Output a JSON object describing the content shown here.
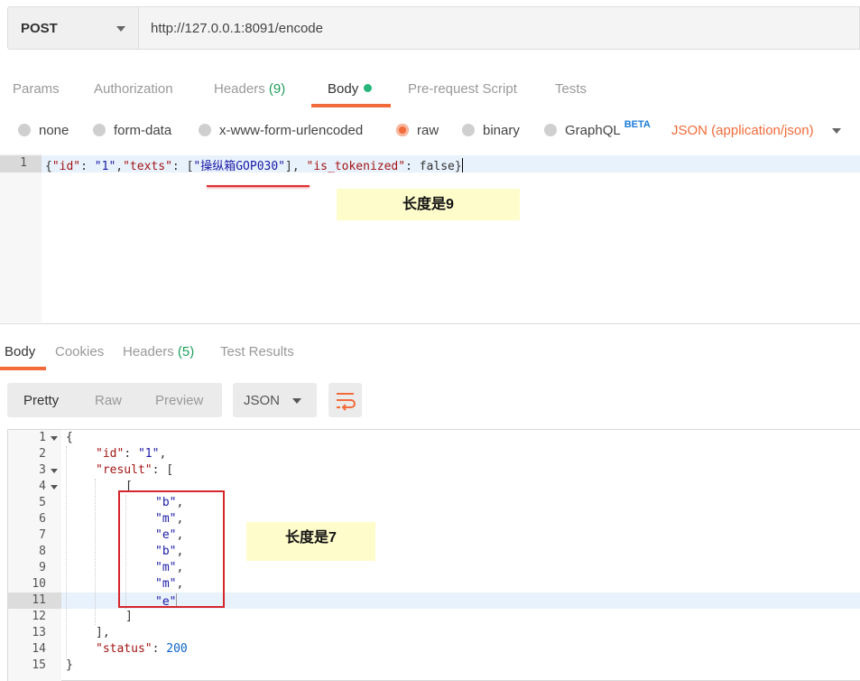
{
  "request": {
    "method": "POST",
    "url": "http://127.0.0.1:8091/encode"
  },
  "request_tabs": [
    {
      "label": "Params"
    },
    {
      "label": "Authorization"
    },
    {
      "label": "Headers",
      "count": "(9)"
    },
    {
      "label": "Body",
      "active": true
    },
    {
      "label": "Pre-request Script"
    },
    {
      "label": "Tests"
    }
  ],
  "body_types": {
    "none": "none",
    "form_data": "form-data",
    "urlencoded": "x-www-form-urlencoded",
    "raw": "raw",
    "binary": "binary",
    "graphql": "GraphQL",
    "beta": "BETA",
    "content_type": "JSON (application/json)"
  },
  "request_editor": {
    "line_number": "1",
    "line": {
      "open": "{",
      "k1": "\"id\"",
      "v1": "\"1\"",
      "k2": "\"texts\"",
      "arr_open": "[",
      "v2": "\"操纵箱GOP030\"",
      "arr_close": "]",
      "k3": "\"is_tokenized\"",
      "v3": "false",
      "close": "}"
    }
  },
  "annotations": {
    "request_note": "长度是9",
    "response_note": "长度是7"
  },
  "response_tabs": [
    {
      "label": "Body",
      "active": true
    },
    {
      "label": "Cookies"
    },
    {
      "label": "Headers",
      "count": "(5)"
    },
    {
      "label": "Test Results"
    }
  ],
  "response_view": {
    "pretty": "Pretty",
    "raw": "Raw",
    "preview": "Preview",
    "format": "JSON",
    "wrap_icon": "wrap-lines-icon"
  },
  "response_lines": [
    {
      "n": "1",
      "t": "{"
    },
    {
      "n": "2",
      "k": "\"id\"",
      "v": "\"1\"",
      "e": ","
    },
    {
      "n": "3",
      "k": "\"result\"",
      "e": "["
    },
    {
      "n": "4",
      "t": "["
    },
    {
      "n": "5",
      "v": "\"b\"",
      "e": ","
    },
    {
      "n": "6",
      "v": "\"m\"",
      "e": ","
    },
    {
      "n": "7",
      "v": "\"e\"",
      "e": ","
    },
    {
      "n": "8",
      "v": "\"b\"",
      "e": ","
    },
    {
      "n": "9",
      "v": "\"m\"",
      "e": ","
    },
    {
      "n": "10",
      "v": "\"m\"",
      "e": ","
    },
    {
      "n": "11",
      "v": "\"e\"",
      "e": ""
    },
    {
      "n": "12",
      "t": "]"
    },
    {
      "n": "13",
      "t": "],"
    },
    {
      "n": "14",
      "k": "\"status\"",
      "num": "200"
    },
    {
      "n": "15",
      "t": "}"
    }
  ],
  "colors": {
    "accent": "#f26b3a",
    "count_green": "#1f9e5c",
    "note_bg": "#fffccc",
    "annotation_red": "#d4262b"
  }
}
